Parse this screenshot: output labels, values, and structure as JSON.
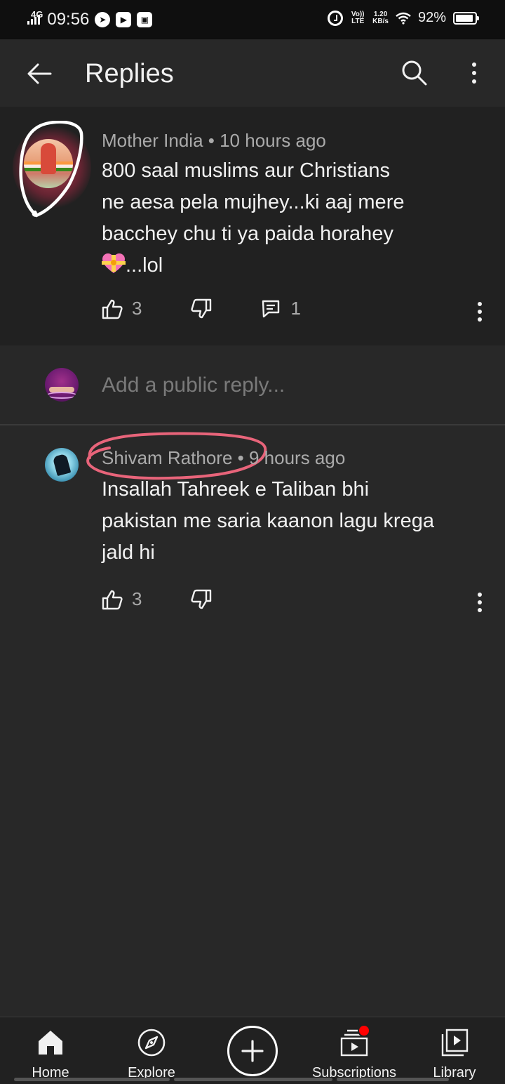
{
  "status_bar": {
    "network": "4G",
    "time": "09:56",
    "volte": "Vo)) LTE",
    "speed_value": "1.20",
    "speed_unit": "KB/s",
    "battery_percent": "92%",
    "battery_level": 0.92
  },
  "header": {
    "title": "Replies"
  },
  "parent_comment": {
    "author": "Mother India",
    "time": "10 hours ago",
    "text_lines": [
      "800 saal muslims aur Christians",
      "ne aesa pela mujhey...ki aaj mere",
      "bacchey chu ti ya paida horahey"
    ],
    "text_tail": "...lol",
    "likes": "3",
    "replies": "1"
  },
  "reply_box": {
    "placeholder": "Add a public reply..."
  },
  "reply": {
    "author": "Shivam Rathore",
    "time": "9 hours ago",
    "text_lines": [
      "Insallah Tahreek e Taliban bhi",
      "pakistan me saria kaanon lagu krega",
      "jald hi"
    ],
    "likes": "3"
  },
  "bottom_nav": {
    "home": "Home",
    "explore": "Explore",
    "subscriptions": "Subscriptions",
    "library": "Library"
  },
  "colors": {
    "background": "#282828",
    "comment_background": "#212121",
    "secondary_text": "#aaaaaa",
    "highlight_annotation": "#e8647a",
    "notification_dot": "#ff0000"
  }
}
